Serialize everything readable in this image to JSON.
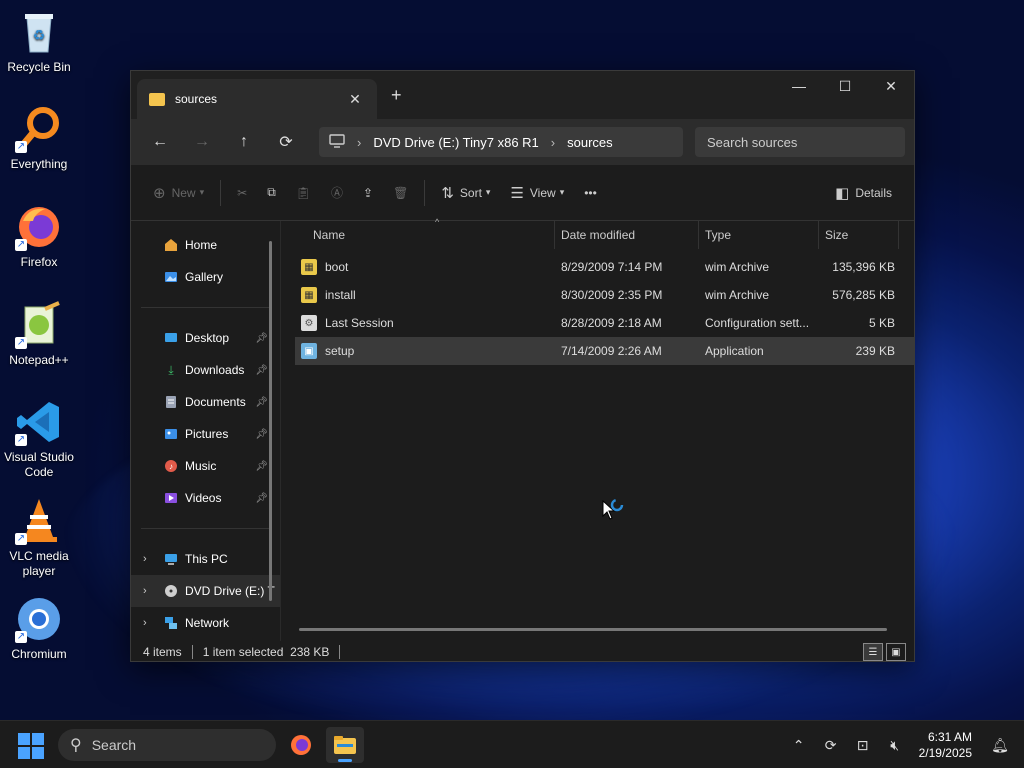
{
  "desktop": {
    "icons": [
      {
        "label": "Recycle Bin",
        "icon": "recycle-bin-icon"
      },
      {
        "label": "Everything",
        "icon": "everything-search-icon"
      },
      {
        "label": "Firefox",
        "icon": "firefox-icon"
      },
      {
        "label": "Notepad++",
        "icon": "notepad-plus-plus-icon"
      },
      {
        "label": "Visual Studio Code",
        "icon": "vscode-icon"
      },
      {
        "label": "VLC media player",
        "icon": "vlc-icon"
      },
      {
        "label": "Chromium",
        "icon": "chromium-icon"
      }
    ]
  },
  "window": {
    "tab_label": "sources",
    "tab_close": "✕",
    "new_tab": "+",
    "controls": {
      "minimize": "—",
      "maximize": "☐",
      "close": "✕"
    },
    "nav": {
      "back": "←",
      "forward": "→",
      "up": "↑",
      "refresh": "⟳"
    },
    "breadcrumb": [
      "DVD Drive (E:) Tiny7 x86 R1",
      "sources"
    ],
    "search_placeholder": "Search sources",
    "toolbar": {
      "new_label": "New",
      "sort_label": "Sort",
      "view_label": "View",
      "more_label": "•••",
      "details_label": "Details"
    },
    "sidebar": {
      "top": [
        {
          "label": "Home",
          "icon": "home-icon",
          "color": "#e8a33c"
        },
        {
          "label": "Gallery",
          "icon": "gallery-icon",
          "color": "#3b8fe8"
        }
      ],
      "pinned": [
        {
          "label": "Desktop",
          "icon": "desktop-folder-icon",
          "color": "#3aa0e8"
        },
        {
          "label": "Downloads",
          "icon": "downloads-folder-icon",
          "color": "#3cbf6a"
        },
        {
          "label": "Documents",
          "icon": "documents-folder-icon",
          "color": "#9aa3b5"
        },
        {
          "label": "Pictures",
          "icon": "pictures-folder-icon",
          "color": "#3b8fe8"
        },
        {
          "label": "Music",
          "icon": "music-folder-icon",
          "color": "#e25b4a"
        },
        {
          "label": "Videos",
          "icon": "videos-folder-icon",
          "color": "#8a4fe0"
        }
      ],
      "tree": [
        {
          "label": "This PC",
          "icon": "this-pc-icon",
          "color": "#3aa0e8"
        },
        {
          "label": "DVD Drive (E:) T",
          "icon": "dvd-drive-icon",
          "color": "#cfcfcf"
        },
        {
          "label": "Network",
          "icon": "network-icon",
          "color": "#3aa0e8"
        }
      ]
    },
    "columns": [
      "Name",
      "Date modified",
      "Type",
      "Size"
    ],
    "files": [
      {
        "name": "boot",
        "date": "8/29/2009 7:14 PM",
        "type": "wim Archive",
        "size": "135,396 KB",
        "icon": "archive-file-icon",
        "color": "#e9c84a"
      },
      {
        "name": "install",
        "date": "8/30/2009 2:35 PM",
        "type": "wim Archive",
        "size": "576,285 KB",
        "icon": "archive-file-icon",
        "color": "#e9c84a"
      },
      {
        "name": "Last Session",
        "date": "8/28/2009 2:18 AM",
        "type": "Configuration sett...",
        "size": "5 KB",
        "icon": "config-file-icon",
        "color": "#dcdcdc"
      },
      {
        "name": "setup",
        "date": "7/14/2009 2:26 AM",
        "type": "Application",
        "size": "239 KB",
        "icon": "setup-app-icon",
        "color": "#6fb3e0"
      }
    ],
    "status": {
      "count": "4 items",
      "selection": "1 item selected  238 KB"
    }
  },
  "taskbar": {
    "search_label": "Search",
    "time": "6:31 AM",
    "date": "2/19/2025"
  }
}
